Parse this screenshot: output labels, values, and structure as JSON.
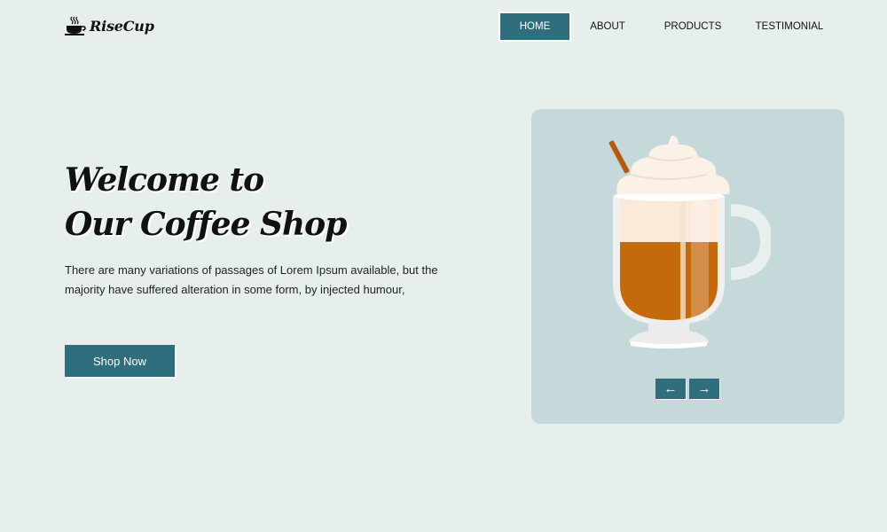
{
  "brand": {
    "name": "RiseCup",
    "icon": "coffee-cup-icon"
  },
  "nav": {
    "items": [
      {
        "label": "HOME",
        "active": true
      },
      {
        "label": "ABOUT",
        "active": false
      },
      {
        "label": "PRODUCTS",
        "active": false
      },
      {
        "label": "TESTIMONIAL",
        "active": false
      }
    ]
  },
  "hero": {
    "title_line1": "Welcome to",
    "title_line2": "Our Coffee Shop",
    "description": "There are many variations of passages of Lorem Ipsum available, but the majority have suffered alteration in some form, by injected humour,",
    "cta_label": "Shop Now"
  },
  "slider": {
    "image": "irish-coffee-glass-image",
    "prev_icon": "←",
    "next_icon": "→"
  },
  "colors": {
    "background": "#e6efec",
    "accent": "#2f6e7d",
    "card": "#c5d9da",
    "coffee": "#c56a0c"
  }
}
